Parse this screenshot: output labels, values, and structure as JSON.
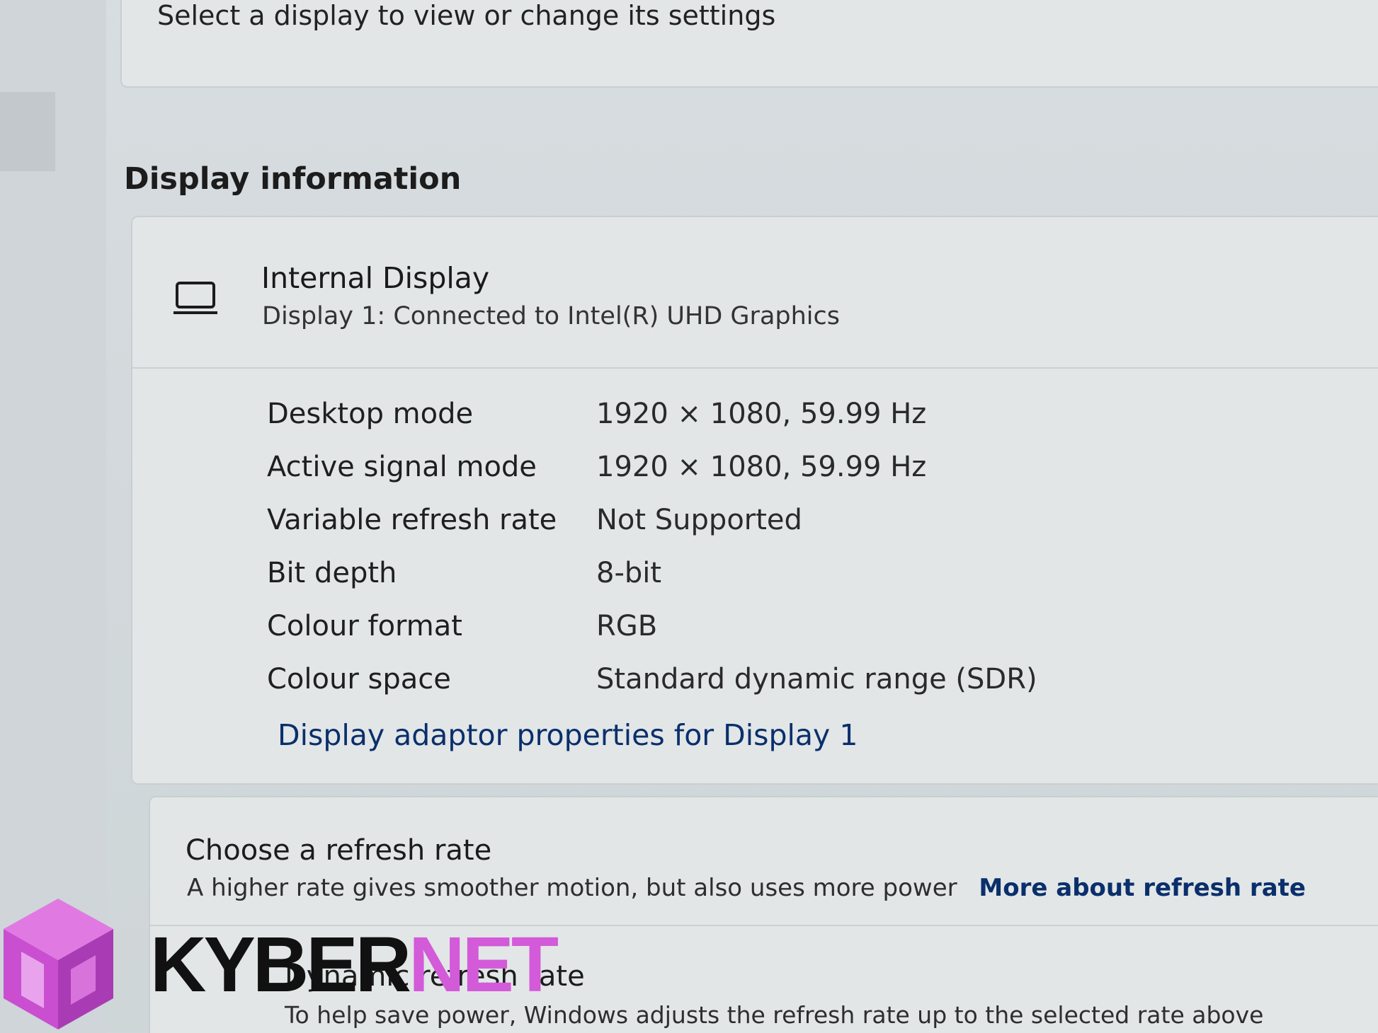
{
  "select_prompt": "Select a display to view or change its settings",
  "section_title": "Display information",
  "display": {
    "icon": "monitor-icon",
    "name": "Internal Display",
    "subtitle": "Display 1: Connected to Intel(R) UHD Graphics"
  },
  "specs": [
    {
      "label": "Desktop mode",
      "value": "1920 × 1080, 59.99 Hz"
    },
    {
      "label": "Active signal mode",
      "value": "1920 × 1080, 59.99 Hz"
    },
    {
      "label": "Variable refresh rate",
      "value": "Not Supported"
    },
    {
      "label": "Bit depth",
      "value": "8-bit"
    },
    {
      "label": "Colour format",
      "value": "RGB"
    },
    {
      "label": "Colour space",
      "value": "Standard dynamic range (SDR)"
    }
  ],
  "adapter_link": "Display adaptor properties for Display 1",
  "refresh": {
    "title": "Choose a refresh rate",
    "description": "A higher rate gives smoother motion, but also uses more power",
    "link": "More about refresh rate"
  },
  "dynamic": {
    "title": "Dynamic refresh rate",
    "description": "To help save power, Windows adjusts the refresh rate up to the selected rate above"
  },
  "watermark": {
    "part1": "KYBER",
    "part2": "NET",
    "accent_color": "#d35ad8"
  }
}
